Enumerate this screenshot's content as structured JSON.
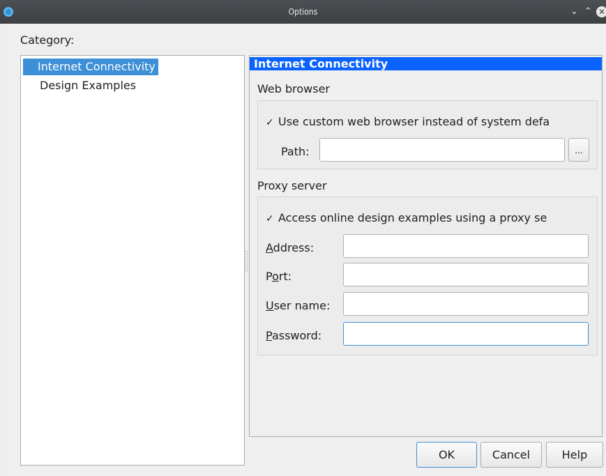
{
  "window": {
    "title": "Options",
    "minimize_icon": "chevron-down",
    "maximize_icon": "chevron-up",
    "close_icon": "close"
  },
  "category": {
    "label": "Category:",
    "items": [
      {
        "label": "Internet Connectivity",
        "selected": true
      },
      {
        "label": "Design Examples",
        "selected": false
      }
    ]
  },
  "panel": {
    "header": "Internet Connectivity",
    "header_color": "#0a62ff",
    "web_browser": {
      "title": "Web browser",
      "checkbox_checked": true,
      "checkbox_label": "Use custom web browser instead of system defa",
      "path_label": "Path:",
      "path_value": "",
      "browse_label": "..."
    },
    "proxy": {
      "title": "Proxy server",
      "checkbox_checked": true,
      "checkbox_label": "Access online design examples using a proxy se",
      "address_label_key": "A",
      "address_label_rest": "ddress:",
      "address_value": "",
      "port_label_pre": "P",
      "port_label_key": "o",
      "port_label_rest": "rt:",
      "port_value": "",
      "user_label_key": "U",
      "user_label_rest": "ser name:",
      "user_value": "",
      "password_label_key": "P",
      "password_label_rest": "assword:",
      "password_value": ""
    }
  },
  "buttons": {
    "ok": "OK",
    "cancel": "Cancel",
    "help": "Help"
  },
  "check_glyph": "✓",
  "accent_color": "#3d8fd6"
}
